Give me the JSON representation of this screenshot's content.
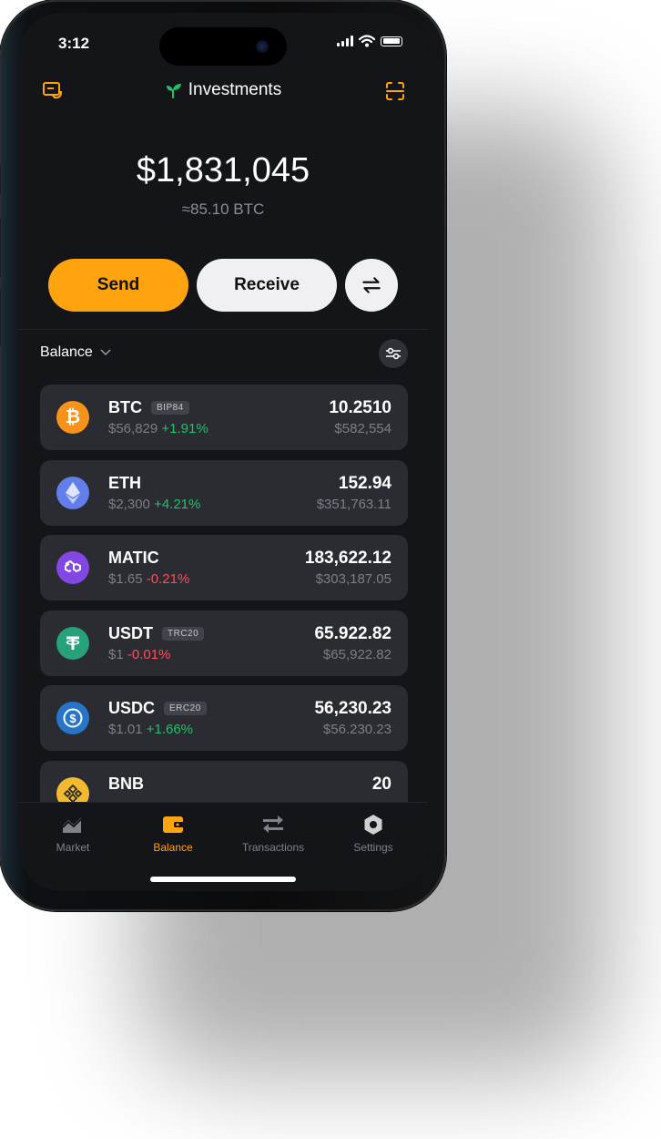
{
  "status_bar": {
    "time": "3:12"
  },
  "header": {
    "title": "Investments"
  },
  "portfolio": {
    "total": "$1,831,045",
    "total_btc": "≈85.10 BTC"
  },
  "actions": {
    "send": "Send",
    "receive": "Receive"
  },
  "section": {
    "label": "Balance"
  },
  "assets": [
    {
      "symbol": "BTC",
      "tag": "BIP84",
      "price": "$56,829",
      "change": "+1.91%",
      "dir": "up",
      "amount": "10.2510",
      "value": "$582,554",
      "color": "#f7931a",
      "icon": "bitcoin-icon"
    },
    {
      "symbol": "ETH",
      "tag": "",
      "price": "$2,300",
      "change": "+4.21%",
      "dir": "up",
      "amount": "152.94",
      "value": "$351,763.11",
      "color": "#627eea",
      "icon": "ethereum-icon"
    },
    {
      "symbol": "MATIC",
      "tag": "",
      "price": "$1.65",
      "change": "-0.21%",
      "dir": "down",
      "amount": "183,622.12",
      "value": "$303,187.05",
      "color": "#8247e5",
      "icon": "polygon-icon"
    },
    {
      "symbol": "USDT",
      "tag": "TRC20",
      "price": "$1",
      "change": "-0.01%",
      "dir": "down",
      "amount": "65.922.82",
      "value": "$65,922.82",
      "color": "#26a17b",
      "icon": "tether-icon"
    },
    {
      "symbol": "USDC",
      "tag": "ERC20",
      "price": "$1.01",
      "change": "+1.66%",
      "dir": "up",
      "amount": "56,230.23",
      "value": "$56.230.23",
      "color": "#2775ca",
      "icon": "usdc-icon"
    },
    {
      "symbol": "BNB",
      "tag": "",
      "price": "",
      "change": "",
      "dir": "down",
      "amount": "20",
      "value": "",
      "color": "#f3ba2f",
      "icon": "bnb-icon"
    }
  ],
  "tabs": {
    "market": "Market",
    "balance": "Balance",
    "transactions": "Transactions",
    "settings": "Settings"
  },
  "colors": {
    "accent": "#ffa30f",
    "up": "#1fc16b",
    "down": "#ff4d5e",
    "background": "#141518",
    "card": "#2a2c31"
  }
}
